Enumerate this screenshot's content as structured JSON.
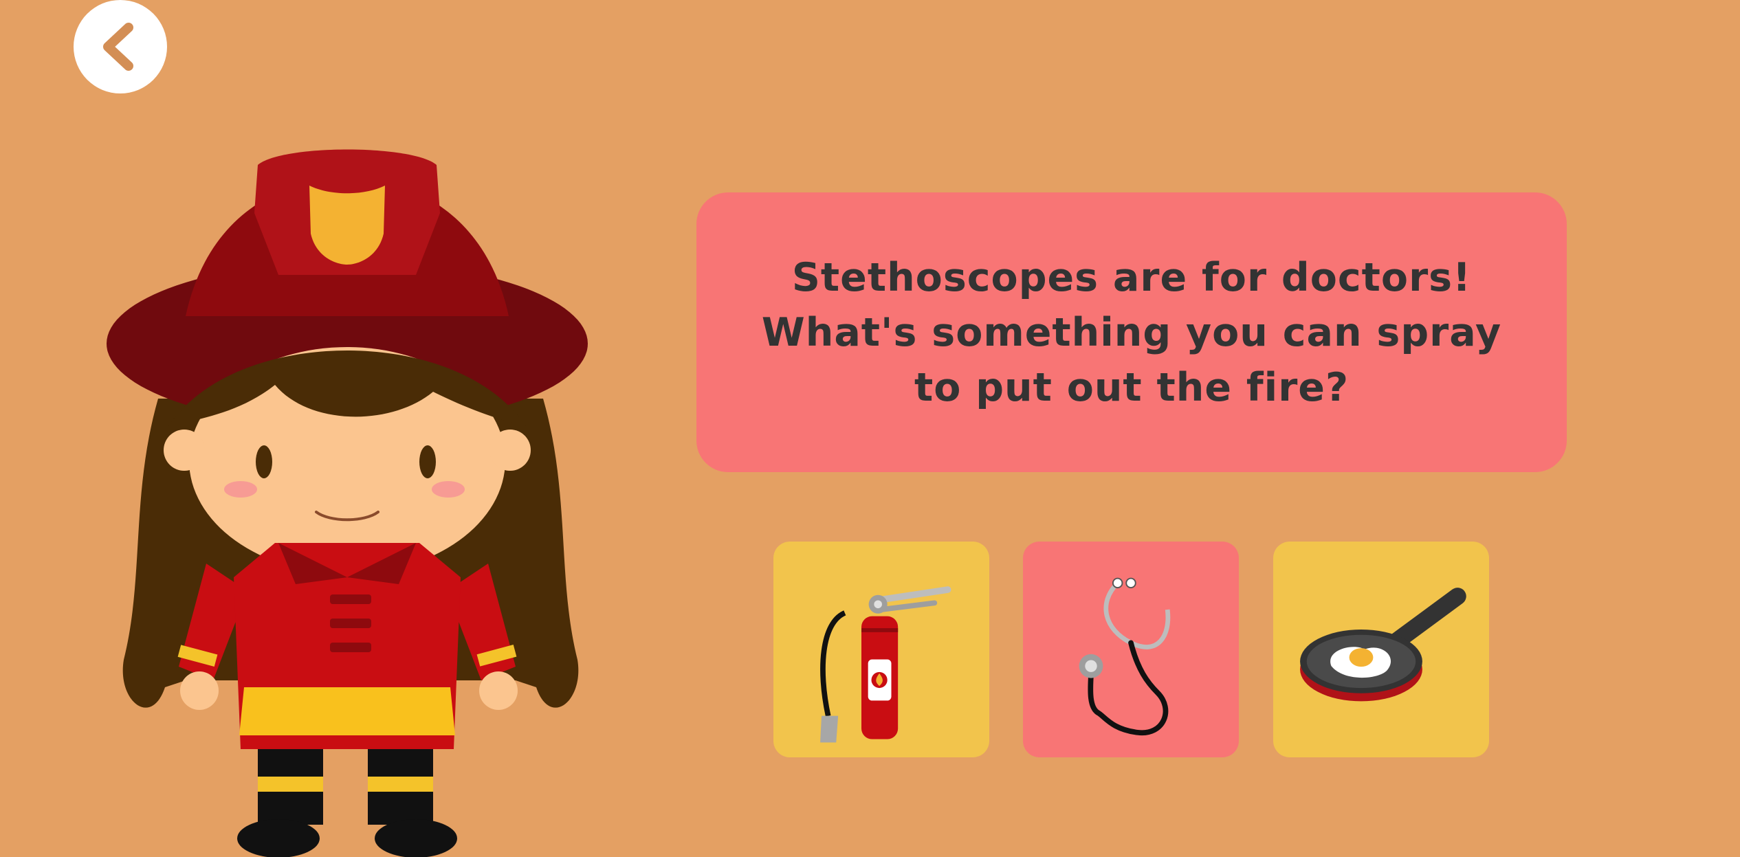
{
  "question": {
    "text": "Stethoscopes are for doctors! What's something you can spray to put out the fire?"
  },
  "choices": [
    {
      "icon": "fire-extinguisher-icon",
      "color": "#F2C44C"
    },
    {
      "icon": "stethoscope-icon",
      "color": "#F87575"
    },
    {
      "icon": "frying-pan-egg-icon",
      "color": "#F2C44C"
    }
  ],
  "colors": {
    "background": "#E4A063",
    "speech_bubble": "#F87575",
    "card_yellow": "#F2C44C",
    "card_pink": "#F87575",
    "text": "#333333"
  },
  "back_button": {
    "icon": "chevron-left-icon"
  },
  "character": {
    "icon": "firefighter-girl-icon"
  }
}
